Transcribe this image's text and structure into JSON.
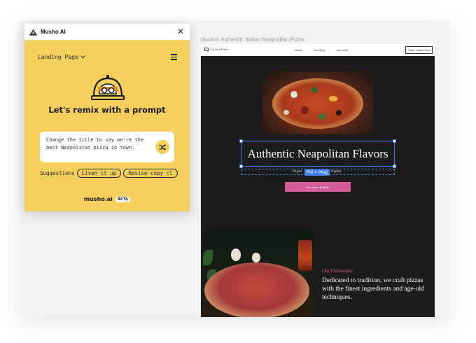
{
  "plugin": {
    "title": "Musho AI",
    "close_icon": "close-icon",
    "page_select": "Landing Page",
    "headline": "Let's remix with a prompt",
    "prompt_value": "Change the title to say we're the best Neapolitan pizza in town.",
    "suggestions_label": "Suggestions",
    "suggestions": [
      "Liven it up",
      "Revise copy cl"
    ],
    "footer_brand": "musho.ai",
    "footer_badge": "BETA",
    "accent": "#f4cf5b"
  },
  "canvas": {
    "frame_label": "musho: Authentic Italian Neapolitan Pizza",
    "nav": {
      "logo": "La Vera Pizza",
      "links": [
        "Home",
        "Our Story",
        "Our Chef"
      ],
      "button": "Order Online Now"
    },
    "hero_title": "Authentic Neapolitan Flavors",
    "subtitle_left": "Experi",
    "subtitle_right": "Naples.",
    "fill_tag": "Fill × Hug",
    "cta": "See Menu & Order",
    "philosophy_label": "Our Philosophy",
    "philosophy_text": "Dedicated to tradition, we craft pizzas with the finest ingredients and age-old techniques.",
    "selection_color": "#3b82f6",
    "brand_pink": "#d65d9a"
  }
}
